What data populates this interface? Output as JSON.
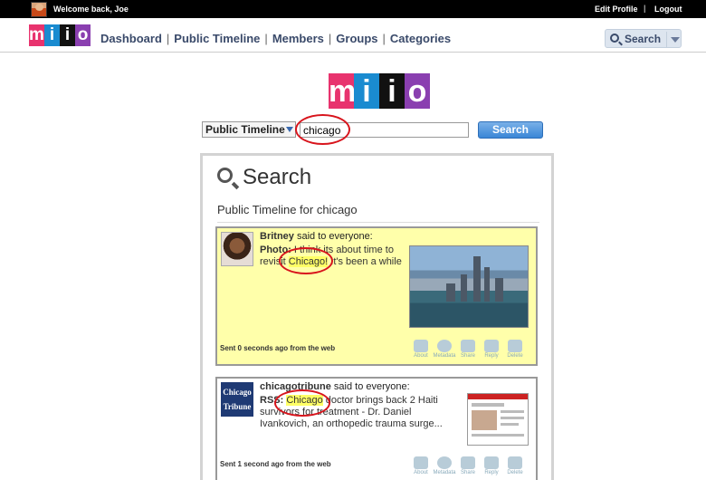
{
  "topbar": {
    "welcome": "Welcome back, Joe",
    "edit_profile": "Edit Profile",
    "separator": "|",
    "logout": "Logout"
  },
  "logo": {
    "letters": [
      "m",
      "i",
      "i",
      "o"
    ],
    "colors": [
      "#e8336e",
      "#1a8bd0",
      "#111111",
      "#8a3fb0"
    ]
  },
  "nav": {
    "items": [
      "Dashboard",
      "Public Timeline",
      "Members",
      "Groups",
      "Categories"
    ],
    "divider": "|",
    "search_label": "Search"
  },
  "search": {
    "scope": "Public Timeline",
    "query": "chicago",
    "button": "Search"
  },
  "results": {
    "title": "Search",
    "heading": "Public Timeline for chicago",
    "posts": [
      {
        "author": "Britney",
        "said": "said to everyone:",
        "type_label": "Photo:",
        "text_before": "I think its about time to revisit",
        "match": "Chicago!",
        "text_after": "It's been a while",
        "timestamp": "Sent 0 seconds ago from the web",
        "image": "chicago-skyline-photo"
      },
      {
        "author": "chicagotribune",
        "said": "said to everyone:",
        "avatar_text": [
          "Chicago",
          "Tribune"
        ],
        "type_label": "RSS:",
        "text_before": "",
        "match": "Chicago",
        "text_after": "doctor brings back 2 Haiti survivors for treatment - Dr. Daniel Ivankovich, an orthopedic trauma surge...",
        "timestamp": "Sent 1 second ago from the web",
        "image": "news-page-thumbnail"
      }
    ],
    "actions": [
      {
        "label": "About",
        "icon": "briefcase-icon"
      },
      {
        "label": "Metadata",
        "icon": "info-icon"
      },
      {
        "label": "Share",
        "icon": "share-icon"
      },
      {
        "label": "Reply",
        "icon": "reply-icon"
      },
      {
        "label": "Delete",
        "icon": "trash-icon"
      }
    ]
  },
  "colors": {
    "highlight_post": "#ffffaa",
    "annotation": "#d8141c",
    "search_button": "#3a86d6"
  }
}
